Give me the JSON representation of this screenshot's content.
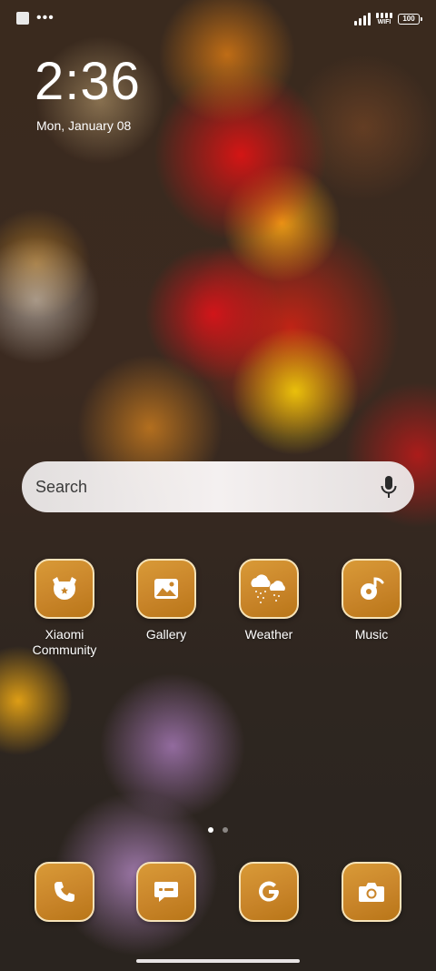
{
  "status_bar": {
    "wifi_label": "WIFI",
    "battery_level": "100"
  },
  "lock": {
    "time": "2:36",
    "date": "Mon, January 08"
  },
  "search": {
    "placeholder": "Search"
  },
  "apps": [
    {
      "label": "Xiaomi Community",
      "icon": "mi-bunny-icon"
    },
    {
      "label": "Gallery",
      "icon": "gallery-icon"
    },
    {
      "label": "Weather",
      "icon": "weather-icon"
    },
    {
      "label": "Music",
      "icon": "music-icon"
    }
  ],
  "page_indicator": {
    "pages": 2,
    "active": 1
  },
  "dock": [
    {
      "icon": "phone-icon"
    },
    {
      "icon": "messages-icon"
    },
    {
      "icon": "google-icon"
    },
    {
      "icon": "camera-icon"
    }
  ],
  "colors": {
    "icon_fill": "#c9852a",
    "icon_border": "#f6e3b8",
    "search_bg": "#f3efef"
  }
}
